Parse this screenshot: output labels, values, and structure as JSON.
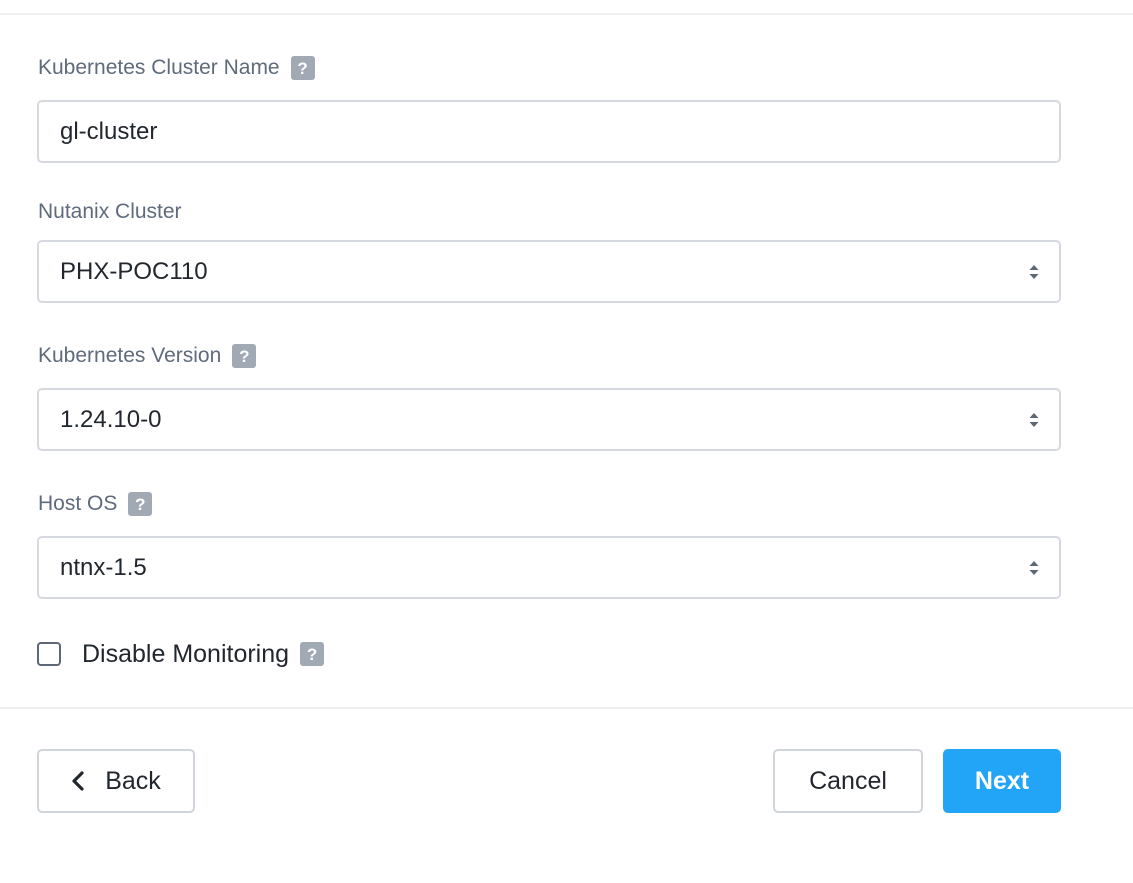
{
  "form": {
    "cluster_name": {
      "label": "Kubernetes Cluster Name",
      "help": "?",
      "value": "gl-cluster"
    },
    "nutanix_cluster": {
      "label": "Nutanix Cluster",
      "value": "PHX-POC110"
    },
    "k8s_version": {
      "label": "Kubernetes Version",
      "help": "?",
      "value": "1.24.10-0"
    },
    "host_os": {
      "label": "Host OS",
      "help": "?",
      "value": "ntnx-1.5"
    },
    "disable_monitoring": {
      "label": "Disable Monitoring",
      "help": "?",
      "checked": false
    }
  },
  "footer": {
    "back_label": "Back",
    "cancel_label": "Cancel",
    "next_label": "Next"
  },
  "colors": {
    "primary": "#22a5f7",
    "label_text": "#5f6b7c",
    "help_badge": "#a1a9b4",
    "border": "#d6dae0"
  },
  "icons": {
    "help": "question-mark-icon",
    "select": "sort-arrows-icon",
    "back": "chevron-left-icon"
  }
}
